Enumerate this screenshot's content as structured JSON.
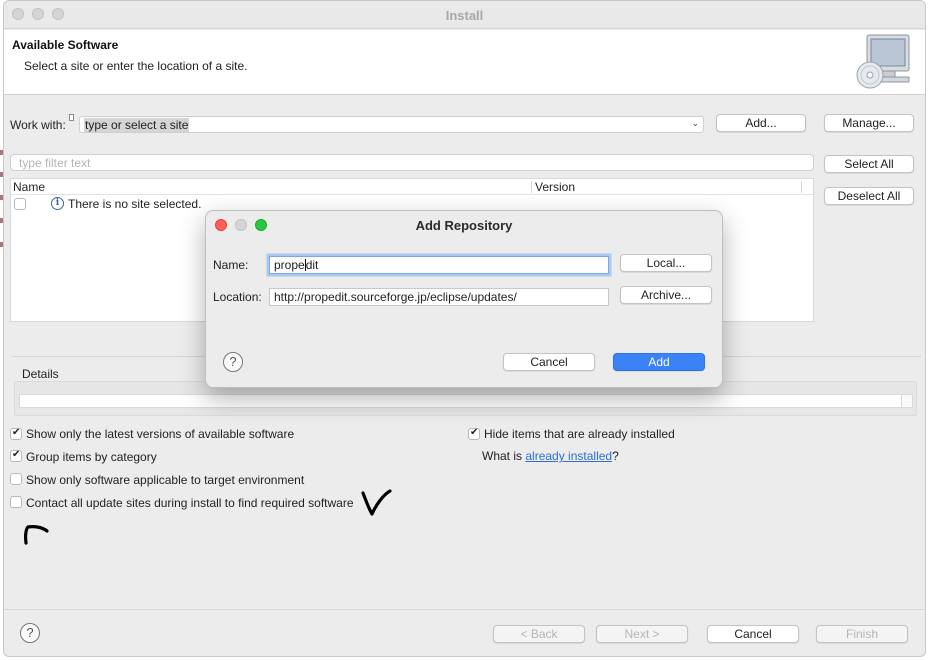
{
  "window": {
    "title": "Install"
  },
  "header": {
    "title": "Available Software",
    "subtitle": "Select a site or enter the location of a site.",
    "icon": "monitor-cd-icon"
  },
  "work_with": {
    "label": "Work with:",
    "value": "type or select a site",
    "add_button": "Add...",
    "manage_button": "Manage..."
  },
  "filter": {
    "placeholder": "type filter text"
  },
  "side_buttons": {
    "select_all": "Select All",
    "deselect_all": "Deselect All"
  },
  "table": {
    "columns": [
      "Name",
      "Version"
    ],
    "rows": [
      {
        "checked": false,
        "text": "There is no site selected."
      }
    ]
  },
  "details": {
    "label": "Details"
  },
  "options": {
    "latest_versions": {
      "label": "Show only the latest versions of available software",
      "checked": true
    },
    "group_by_category": {
      "label": "Group items by category",
      "checked": true
    },
    "target_env": {
      "label": "Show only software applicable to target environment",
      "checked": false
    },
    "contact_sites": {
      "label": "Contact all update sites during install to find required software",
      "checked": false
    },
    "hide_installed": {
      "label": "Hide items that are already installed",
      "checked": true
    },
    "what_is_prefix": "What is",
    "what_is_link": "already installed",
    "what_is_suffix": "?"
  },
  "footer": {
    "back": "< Back",
    "next": "Next >",
    "cancel": "Cancel",
    "finish": "Finish"
  },
  "dialog": {
    "title": "Add Repository",
    "name_label": "Name:",
    "name_value_before_caret": "prope",
    "name_value_after_caret": "dit",
    "location_label": "Location:",
    "location_value": "http://propedit.sourceforge.jp/eclipse/updates/",
    "local_button": "Local...",
    "archive_button": "Archive...",
    "cancel_button": "Cancel",
    "add_button": "Add"
  },
  "colors": {
    "accent": "#3b82f6",
    "link": "#2b6fd0",
    "close": "#fe5f57",
    "minimize": "#febc2e",
    "zoom": "#28c840"
  }
}
